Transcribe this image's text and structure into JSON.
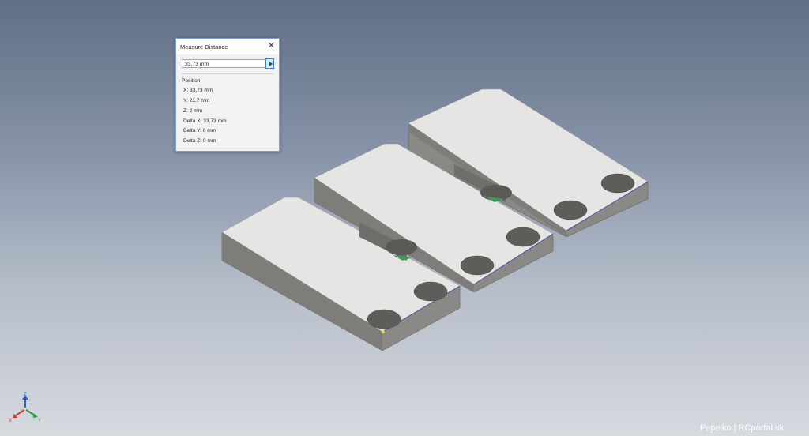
{
  "dialog": {
    "title": "Measure Distance",
    "measurement": "33,73 mm",
    "position_label": "Position",
    "x": "X: 33,73 mm",
    "y": "Y: 21,7 mm",
    "z": "Z: 2 mm",
    "delta_x": "Delta X: 33,73 mm",
    "delta_y": "Delta Y: 0 mm",
    "delta_z": "Delta Z: 0 mm"
  },
  "axes": {
    "x": "X",
    "y": "Y",
    "z": "Z"
  },
  "colors": {
    "x_axis": "#d23a2a",
    "y_axis": "#2e9e3a",
    "z_axis": "#3060c8",
    "part_top": "#e6e5e3",
    "part_side": "#8a8985"
  },
  "watermark": "Pepelko | RCportal.sk"
}
